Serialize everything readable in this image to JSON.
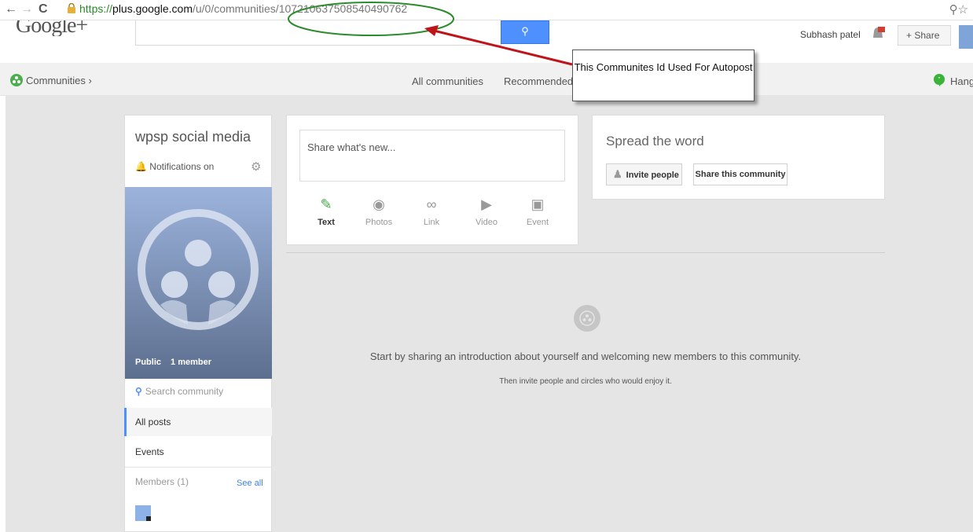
{
  "browser": {
    "url_scheme": "https://",
    "url_host": "plus.google.com",
    "url_path": "/u/0/communities/107210637508540490762"
  },
  "header": {
    "logo": "Google+",
    "user_name": "Subhash patel",
    "share_label": "+ Share"
  },
  "subnav": {
    "communities_label": "Communities ›",
    "all_communities": "All communities",
    "recommended": "Recommended for you",
    "hangouts": "Hangouts"
  },
  "community": {
    "name": "wpsp social media",
    "notifications": "Notifications on",
    "visibility": "Public",
    "member_count": "1 member",
    "search_placeholder": "Search community",
    "nav_all_posts": "All posts",
    "nav_events": "Events",
    "members_label": "Members (1)",
    "see_all": "See all"
  },
  "share_box": {
    "placeholder": "Share what's new...",
    "tools": [
      {
        "label": "Text",
        "icon": "pencil-icon"
      },
      {
        "label": "Photos",
        "icon": "camera-icon"
      },
      {
        "label": "Link",
        "icon": "link-icon"
      },
      {
        "label": "Video",
        "icon": "video-icon"
      },
      {
        "label": "Event",
        "icon": "calendar-icon"
      }
    ]
  },
  "spread": {
    "title": "Spread the word",
    "invite": "Invite people",
    "share_community": "Share this community"
  },
  "empty_state": {
    "message": "Start by sharing an introduction about yourself and welcoming new members to this community.",
    "sub": "Then invite people and circles who would enjoy it."
  },
  "annotation": {
    "callout": "This Communites Id Used For Autopost"
  },
  "colors": {
    "accent_blue": "#4d90fe",
    "annotation_green": "#2e8b2e",
    "arrow_red": "#c0141b"
  }
}
